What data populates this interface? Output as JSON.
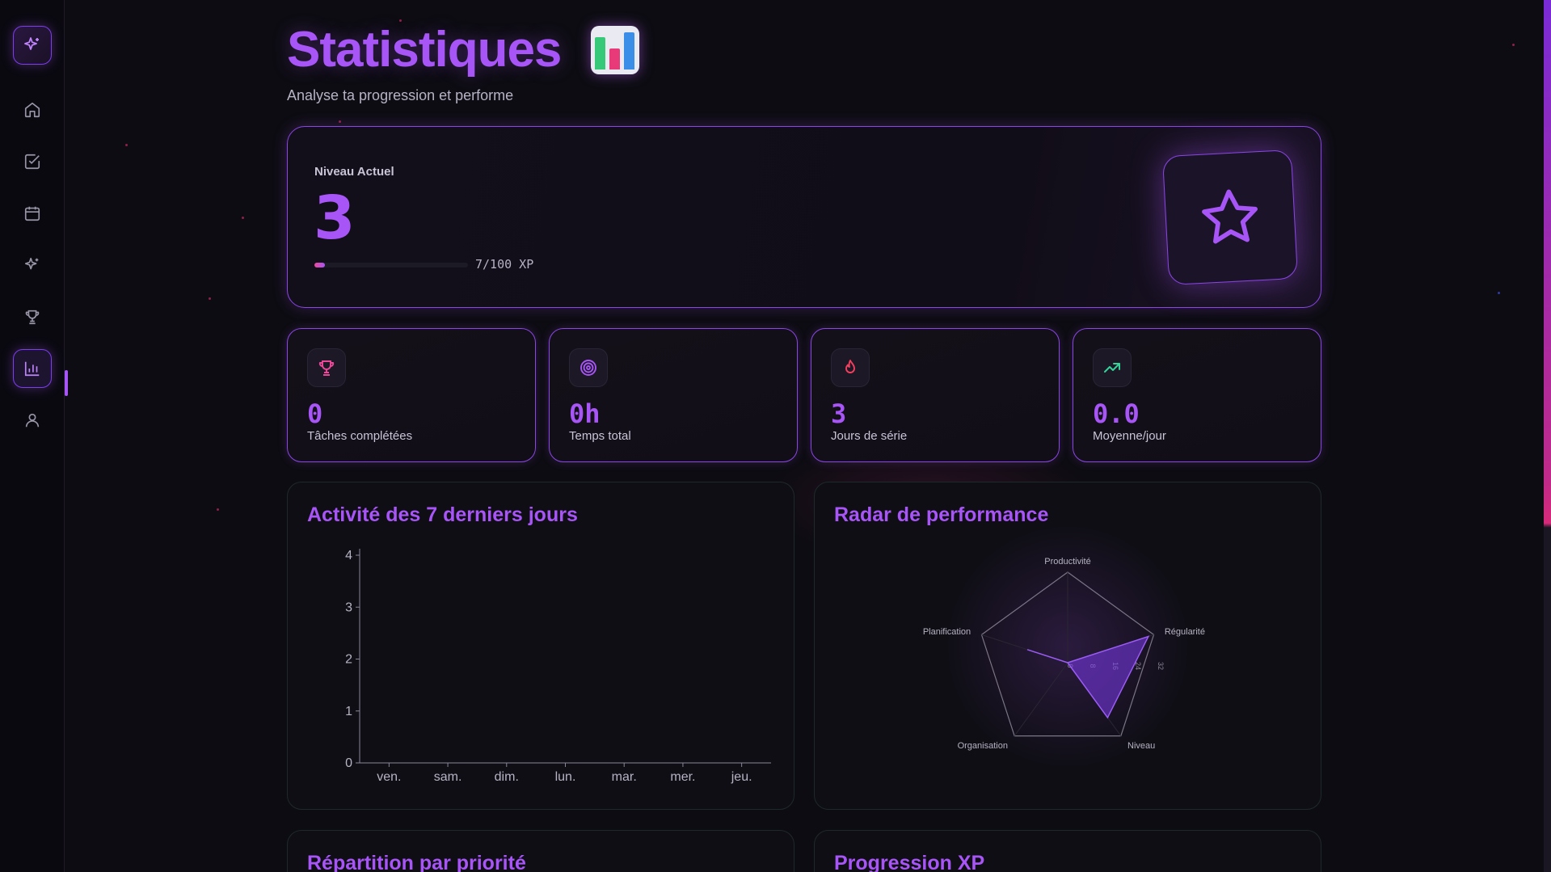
{
  "header": {
    "title": "Statistiques",
    "subtitle": "Analyse ta progression et performe",
    "emoji_icon": "bar-chart-emoji"
  },
  "sidebar": {
    "items": [
      {
        "icon": "sparkles-icon"
      },
      {
        "icon": "home-icon"
      },
      {
        "icon": "check-square-icon"
      },
      {
        "icon": "calendar-icon"
      },
      {
        "icon": "sparkles-icon"
      },
      {
        "icon": "trophy-icon"
      },
      {
        "icon": "bar-chart-icon",
        "active": true
      },
      {
        "icon": "user-icon"
      }
    ]
  },
  "level": {
    "label": "Niveau Actuel",
    "value": "3",
    "xp_text": "7/100 XP",
    "xp_progress": 0.07
  },
  "stats": [
    {
      "value": "0",
      "label": "Tâches complétées",
      "icon": "trophy-icon",
      "color": "#ec4899"
    },
    {
      "value": "0h",
      "label": "Temps total",
      "icon": "target-icon",
      "color": "#a855f7"
    },
    {
      "value": "3",
      "label": "Jours de série",
      "icon": "flame-icon",
      "color": "#f43f5e"
    },
    {
      "value": "0.0",
      "label": "Moyenne/jour",
      "icon": "trending-up-icon",
      "color": "#34d399"
    }
  ],
  "activity": {
    "title": "Activité des 7 derniers jours",
    "chart_data": {
      "type": "bar",
      "categories": [
        "ven.",
        "sam.",
        "dim.",
        "lun.",
        "mar.",
        "mer.",
        "jeu."
      ],
      "values": [
        0,
        0,
        0,
        0,
        0,
        0,
        0
      ],
      "y_ticks": [
        "0",
        "1",
        "2",
        "3",
        "4"
      ],
      "ylim": [
        0,
        4
      ]
    }
  },
  "radar": {
    "title": "Radar de performance",
    "chart_data": {
      "type": "radar",
      "axes": [
        "Productivité",
        "Régularité",
        "Niveau",
        "Organisation",
        "Planification"
      ],
      "values": [
        0,
        30,
        24,
        0,
        15
      ],
      "r_ticks": [
        "0",
        "8",
        "16",
        "24",
        "32"
      ],
      "rlim": [
        0,
        32
      ]
    }
  },
  "bottom_cards": [
    {
      "title": "Répartition par priorité"
    },
    {
      "title": "Progression XP"
    }
  ],
  "colors": {
    "accent": "#a855f7",
    "pink": "#ec4899",
    "background": "#0d0c12"
  }
}
